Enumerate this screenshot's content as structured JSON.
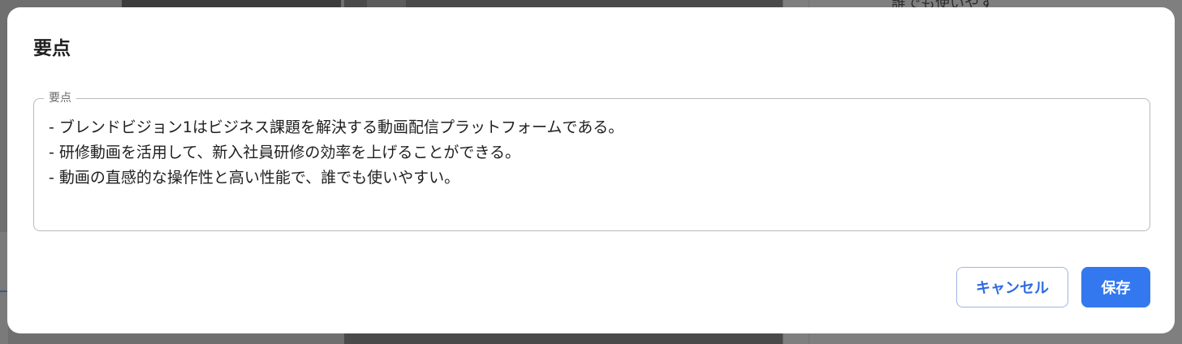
{
  "background": {
    "right_panel_text": "誰でも使いやす"
  },
  "dialog": {
    "title": "要点",
    "field": {
      "label": "要点",
      "value": "- ブレンドビジョン1はビジネス課題を解決する動画配信プラットフォームである。\n- 研修動画を活用して、新入社員研修の効率を上げることができる。\n- 動画の直感的な操作性と高い性能で、誰でも使いやすい。"
    },
    "buttons": {
      "cancel_label": "キャンセル",
      "save_label": "保存"
    }
  },
  "colors": {
    "accent": "#3478f0",
    "overlay": "#7a7a7a"
  }
}
